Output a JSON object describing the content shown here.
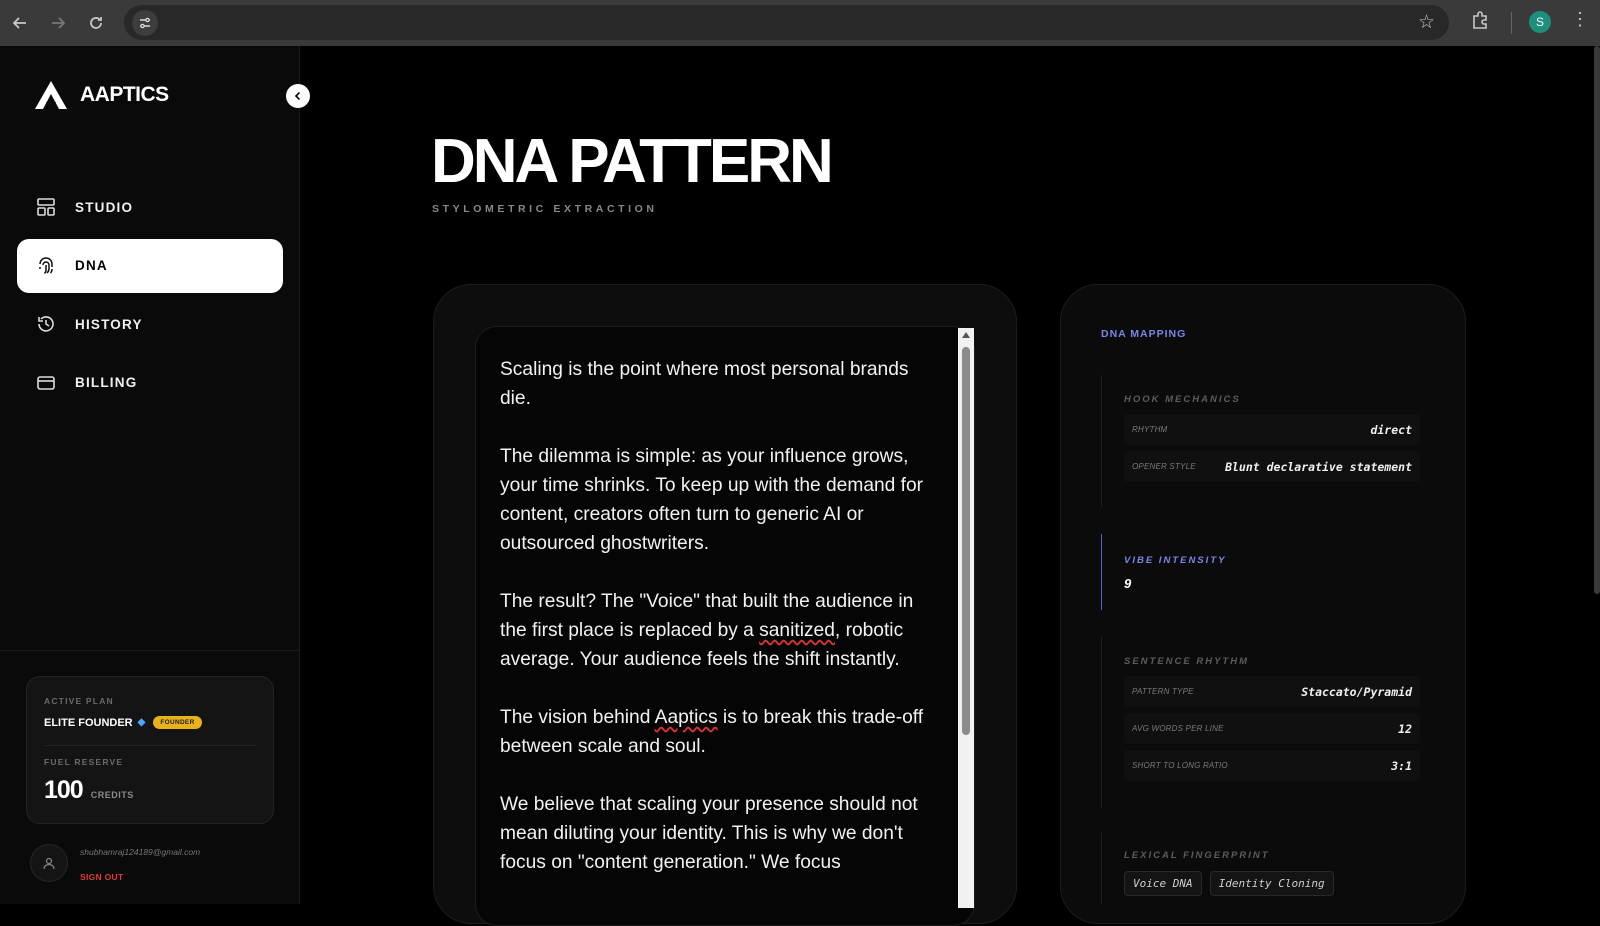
{
  "browser": {
    "back_icon": "arrow-left-icon",
    "forward_icon": "arrow-right-icon",
    "reload_icon": "reload-icon",
    "profile_initial": "S",
    "profile_color": "#1c8f7d"
  },
  "brand": {
    "name": "AAPTICS"
  },
  "sidebar": {
    "items": [
      {
        "label": "STUDIO",
        "icon": "layout-icon",
        "active": false
      },
      {
        "label": "DNA",
        "icon": "fingerprint-icon",
        "active": true
      },
      {
        "label": "HISTORY",
        "icon": "history-icon",
        "active": false
      },
      {
        "label": "BILLING",
        "icon": "credit-card-icon",
        "active": false
      }
    ],
    "plan": {
      "active_plan_label": "ACTIVE PLAN",
      "plan_name": "ELITE FOUNDER",
      "badge": "FOUNDER",
      "fuel_label": "FUEL RESERVE",
      "credits_value": "100",
      "credits_unit": "CREDITS"
    },
    "user": {
      "email": "shubhamraj124189@gmail.com",
      "sign_out": "SIGN OUT"
    }
  },
  "page": {
    "title": "DNA PATTERN",
    "subtitle": "STYLOMETRIC EXTRACTION"
  },
  "editor": {
    "p1": "Scaling is the point where most personal brands die.",
    "p2": "The dilemma is simple: as your influence grows, your time shrinks. To keep up with the demand for content, creators often turn to generic AI or outsourced ghostwriters.",
    "p3_a": "The result? The \"Voice\" that built the audience in the first place is replaced by a ",
    "p3_sq": "sanitized",
    "p3_b": ", robotic average. Your audience feels the shift instantly.",
    "p4_a": "The vision behind ",
    "p4_sq": "Aaptics",
    "p4_b": " is to break this trade-off between scale and soul.",
    "p5": "We believe that scaling your presence should not mean diluting your identity. This is why we don't focus on \"content generation.\" We focus"
  },
  "mapping": {
    "title": "DNA MAPPING",
    "hook": {
      "title": "HOOK MECHANICS",
      "rhythm_label": "RHYTHM",
      "rhythm_value": "direct",
      "opener_label": "OPENER STYLE",
      "opener_value": "Blunt declarative statement"
    },
    "vibe": {
      "title": "VIBE INTENSITY",
      "value": "9"
    },
    "sentence": {
      "title": "SENTENCE RHYTHM",
      "pattern_label": "PATTERN TYPE",
      "pattern_value": "Staccato/Pyramid",
      "avg_label": "AVG WORDS PER LINE",
      "avg_value": "12",
      "ratio_label": "SHORT TO LONG RATIO",
      "ratio_value": "3:1"
    },
    "lexical": {
      "title": "LEXICAL FINGERPRINT",
      "tags": [
        "Voice DNA",
        "Identity Cloning"
      ]
    }
  },
  "colors": {
    "accent": "#7b86e8",
    "badge": "#e8b21c",
    "danger": "#e23a3a"
  }
}
